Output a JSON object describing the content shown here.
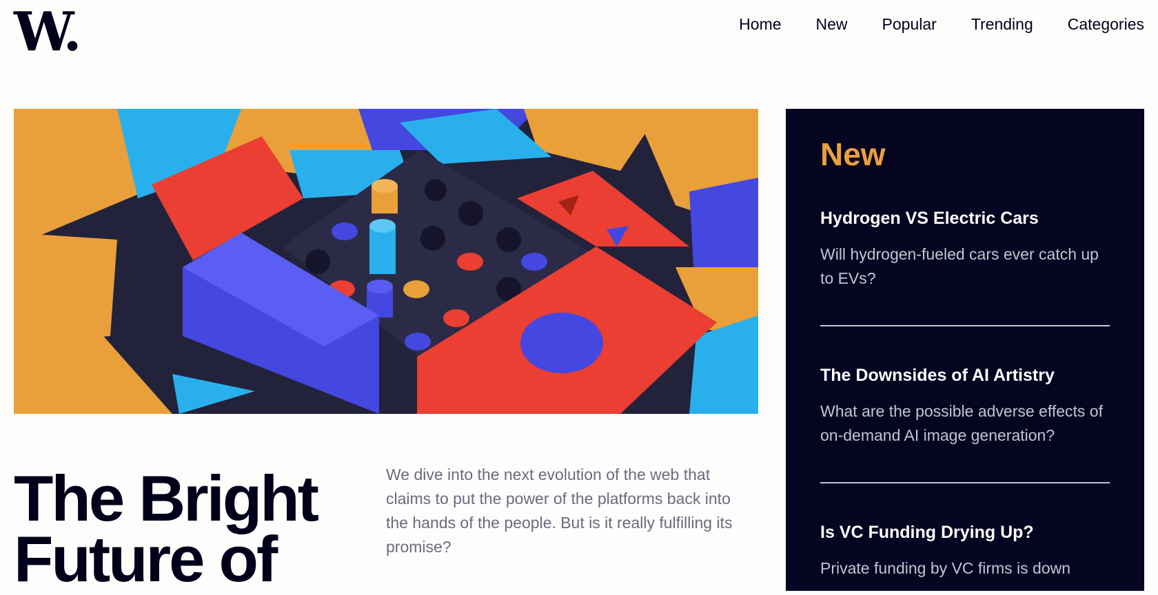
{
  "brand": {
    "logo_text": "W."
  },
  "nav": {
    "items": [
      "Home",
      "New",
      "Popular",
      "Trending",
      "Categories"
    ]
  },
  "hero": {
    "image": "colorful-3d-blocks-image",
    "colors": {
      "orange": "#e9a03b",
      "blue": "#4447e0",
      "red": "#ea3f32",
      "cyan": "#29b0ec",
      "dark": "#2a2a45"
    }
  },
  "feature": {
    "title_line1": "The Bright",
    "title_line2": "Future of",
    "lede": "We dive into the next evolution of the web that claims to put the power of the platforms back into the hands of the people. But is it really fulfilling its promise?"
  },
  "sidebar": {
    "heading": "New",
    "articles": [
      {
        "title": "Hydrogen VS Electric Cars",
        "summary": "Will hydrogen-fueled cars ever catch up to EVs?"
      },
      {
        "title": "The Downsides of AI Artistry",
        "summary": "What are the possible adverse effects of on-demand AI image generation?"
      },
      {
        "title": "Is VC Funding Drying Up?",
        "summary": "Private funding by VC firms is down"
      }
    ]
  },
  "colors": {
    "accent": "#e9a03b",
    "sidebar_bg": "#050521",
    "text_dark": "#00001a",
    "text_muted": "#6b6a7d"
  }
}
